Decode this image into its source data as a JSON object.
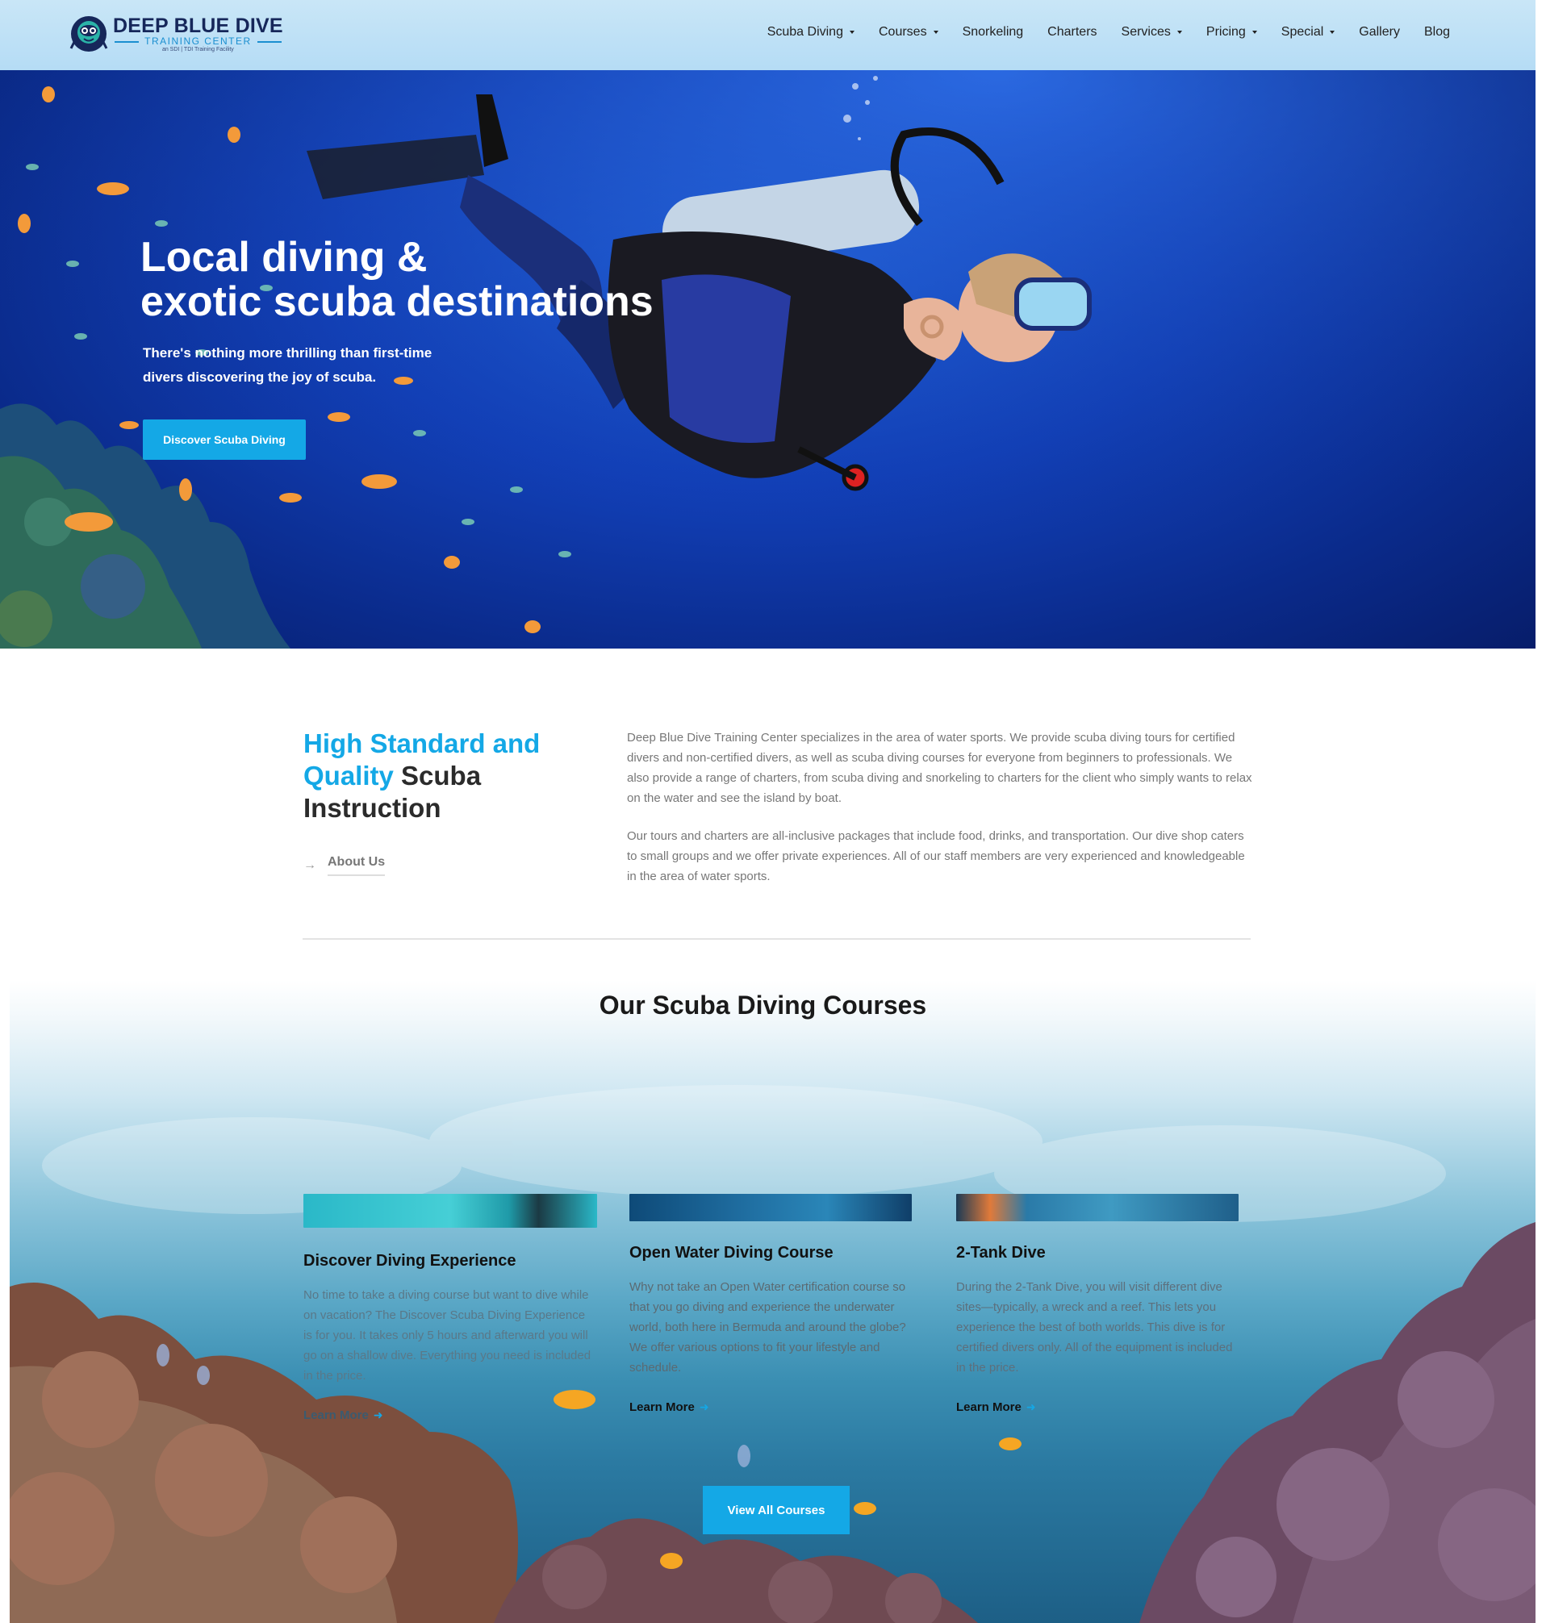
{
  "header": {
    "logo": {
      "title": "DEEP BLUE DIVE",
      "subtitle": "TRAINING CENTER",
      "tagline": "an SDI | TDI Training Facility"
    },
    "nav": [
      {
        "label": "Scuba Diving",
        "has_dropdown": true
      },
      {
        "label": "Courses",
        "has_dropdown": true
      },
      {
        "label": "Snorkeling",
        "has_dropdown": false
      },
      {
        "label": "Charters",
        "has_dropdown": false
      },
      {
        "label": "Services",
        "has_dropdown": true
      },
      {
        "label": "Pricing",
        "has_dropdown": true
      },
      {
        "label": "Special",
        "has_dropdown": true
      },
      {
        "label": "Gallery",
        "has_dropdown": false
      },
      {
        "label": "Blog",
        "has_dropdown": false
      }
    ]
  },
  "hero": {
    "title_line1": "Local diving &",
    "title_line2": "exotic scuba destinations",
    "subtitle": "There's nothing more thrilling than first-time divers discovering the joy of scuba.",
    "button_label": "Discover Scuba Diving"
  },
  "about": {
    "heading_accent": "High Standard and Quality",
    "heading_rest": " Scuba Instruction",
    "link_label": "About Us",
    "paragraph1": "Deep Blue Dive Training Center specializes in the area of water sports. We provide scuba diving tours for certified divers and non-certified divers, as well as scuba diving courses for everyone from beginners to professionals. We also provide a range of charters, from scuba diving and snorkeling to charters for the client who simply wants to relax on the water and see the island by boat.",
    "paragraph2": "Our tours and charters are all-inclusive packages that include food, drinks, and transportation. Our dive shop caters to small groups and we offer private experiences. All of our staff members are very experienced and knowledgeable in the area of water sports."
  },
  "courses": {
    "title": "Our Scuba Diving Courses",
    "items": [
      {
        "title": "Discover Diving Experience",
        "text": "No time to take a diving course but want to dive while on vacation? The Discover Scuba Diving Experience is for you. It takes only 5 hours and afterward you will go on a shallow dive. Everything you need is included in the price.",
        "link": "Learn More"
      },
      {
        "title": "Open Water Diving Course",
        "text": "Why not take an Open Water certification course so that you go diving and experience the underwater world, both here in Bermuda and around the globe? We offer various options to fit your lifestyle and schedule.",
        "link": "Learn More"
      },
      {
        "title": "2-Tank Dive",
        "text": "During the 2-Tank Dive, you will visit different dive sites—typically, a wreck and a reef. This lets you experience the best of both worlds. This dive is for certified divers only. All of the equipment is included in the price.",
        "link": "Learn More"
      }
    ],
    "button_label": "View All Courses"
  },
  "colors": {
    "accent": "#14a8e6",
    "brand_navy": "#16275a",
    "hero_blue": "#1240b8"
  },
  "icons": [
    "diver-logo-icon",
    "dropdown-caret-icon",
    "arrow-right-icon"
  ]
}
